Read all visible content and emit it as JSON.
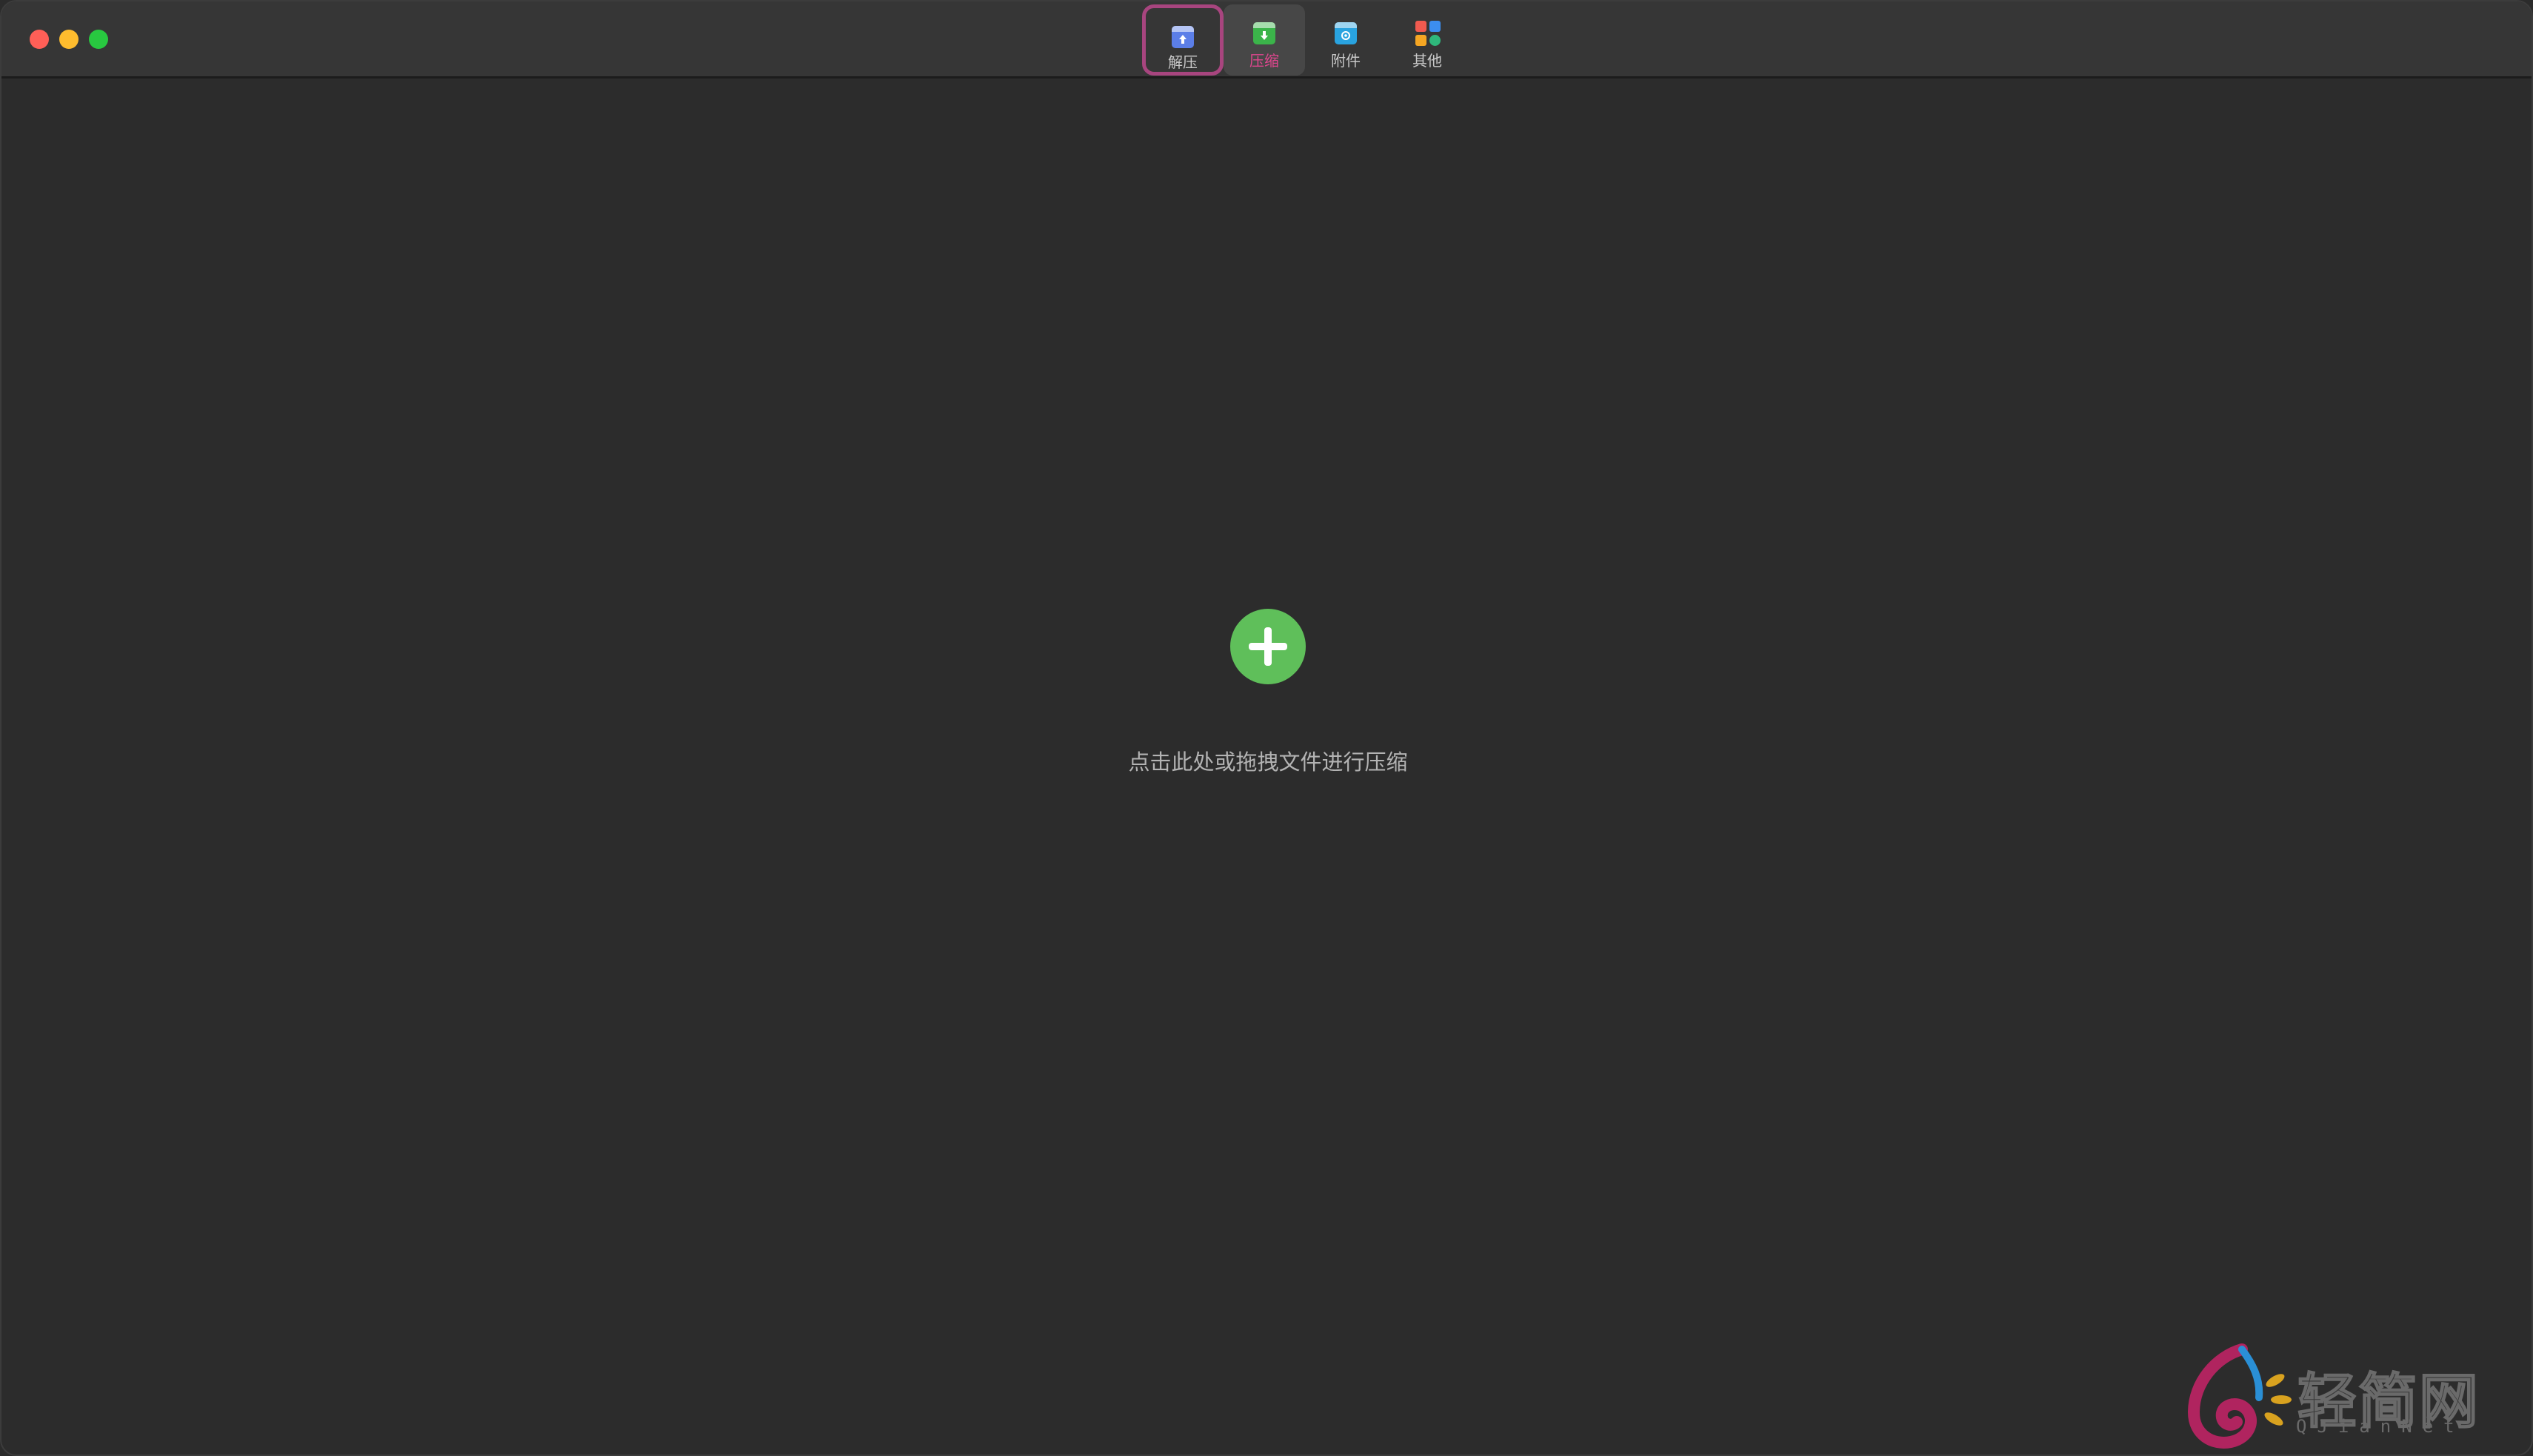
{
  "window": {
    "traffic_lights": [
      "close",
      "minimize",
      "maximize"
    ]
  },
  "toolbar": {
    "items": [
      {
        "label": "解压",
        "icon": "archive-extract-icon",
        "color": "#5b7ee8",
        "highlighted": true
      },
      {
        "label": "压缩",
        "icon": "archive-compress-icon",
        "color": "#3bb44a",
        "active": true
      },
      {
        "label": "附件",
        "icon": "attachment-box-icon",
        "color": "#29a3e0"
      },
      {
        "label": "其他",
        "icon": "apps-grid-icon",
        "colors": [
          "#f05a4f",
          "#3c8ef0",
          "#f5a623",
          "#2fb87c"
        ]
      }
    ]
  },
  "main": {
    "add_button_icon": "plus-circle-icon",
    "add_button_color": "#5fbf5a",
    "hint": "点击此处或拖拽文件进行压缩"
  },
  "watermark": {
    "text": "轻简网",
    "sub": "QJianNet"
  }
}
